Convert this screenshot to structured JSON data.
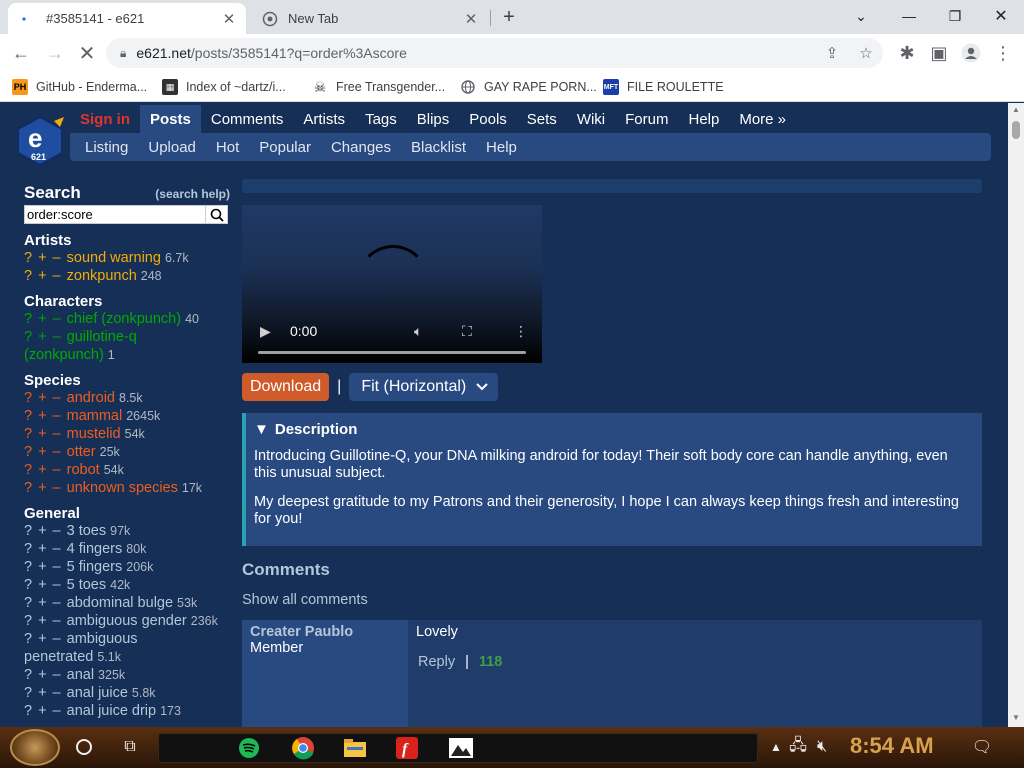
{
  "browser": {
    "tabs": [
      {
        "title": "#3585141 - e621",
        "active": true
      },
      {
        "title": "New Tab",
        "active": false
      }
    ],
    "url_host": "e621.net",
    "url_path": "/posts/3585141?q=order%3Ascore",
    "bookmarks": [
      {
        "label": "GitHub - Enderma...",
        "icon": "PH"
      },
      {
        "label": "Index of ~dartz/i...",
        "icon": "grid"
      },
      {
        "label": "Free Transgender...",
        "icon": "skull"
      },
      {
        "label": "GAY RAPE PORN...",
        "icon": "globe"
      },
      {
        "label": "FILE ROULETTE",
        "icon": "MFT"
      }
    ]
  },
  "site": {
    "nav": {
      "signin": "Sign in",
      "items": [
        "Posts",
        "Comments",
        "Artists",
        "Tags",
        "Blips",
        "Pools",
        "Sets",
        "Wiki",
        "Forum",
        "Help",
        "More »"
      ],
      "subitems": [
        "Listing",
        "Upload",
        "Hot",
        "Popular",
        "Changes",
        "Blacklist",
        "Help"
      ]
    },
    "search": {
      "title": "Search",
      "help": "(search help)",
      "value": "order:score"
    },
    "tag_groups": {
      "artists": {
        "title": "Artists",
        "tags": [
          {
            "name": "sound warning",
            "count": "6.7k"
          },
          {
            "name": "zonkpunch",
            "count": "248"
          }
        ]
      },
      "characters": {
        "title": "Characters",
        "tags": [
          {
            "name": "chief (zonkpunch)",
            "count": "40"
          },
          {
            "name": "guillotine-q (zonkpunch)",
            "count": "1"
          }
        ]
      },
      "species": {
        "title": "Species",
        "tags": [
          {
            "name": "android",
            "count": "8.5k"
          },
          {
            "name": "mammal",
            "count": "2645k"
          },
          {
            "name": "mustelid",
            "count": "54k"
          },
          {
            "name": "otter",
            "count": "25k"
          },
          {
            "name": "robot",
            "count": "54k"
          },
          {
            "name": "unknown species",
            "count": "17k"
          }
        ]
      },
      "general": {
        "title": "General",
        "tags": [
          {
            "name": "3 toes",
            "count": "97k"
          },
          {
            "name": "4 fingers",
            "count": "80k"
          },
          {
            "name": "5 fingers",
            "count": "206k"
          },
          {
            "name": "5 toes",
            "count": "42k"
          },
          {
            "name": "abdominal bulge",
            "count": "53k"
          },
          {
            "name": "ambiguous gender",
            "count": "236k"
          },
          {
            "name": "ambiguous penetrated",
            "count": "5.1k"
          },
          {
            "name": "anal",
            "count": "325k"
          },
          {
            "name": "anal juice",
            "count": "5.8k"
          },
          {
            "name": "anal juice drip",
            "count": "173"
          }
        ]
      }
    },
    "video": {
      "time": "0:00"
    },
    "actions": {
      "download": "Download",
      "separator": "|",
      "fit": "Fit (Horizontal)"
    },
    "description": {
      "title": "Description",
      "paragraphs": [
        "Introducing Guillotine-Q, your DNA milking android for today! Their soft body core can handle anything, even this unusual subject.",
        "My deepest gratitude to my Patrons and their generosity, I hope I can always keep things fresh and interesting for you!"
      ]
    },
    "comments": {
      "title": "Comments",
      "show_all": "Show all comments",
      "items": [
        {
          "author": "Creater Paublo",
          "level": "Member",
          "body": "Lovely",
          "reply": "Reply",
          "separator": "|",
          "score": "118"
        }
      ]
    }
  },
  "taskbar": {
    "clock": "8:54 AM"
  },
  "colors": {
    "site_bg": "#152f56",
    "nav_active": "#284a81",
    "artist_tag": "#f2ac08",
    "character_tag": "#00aa00",
    "species_tag": "#ed5d1f",
    "general_tag": "#b4c7d9",
    "download_button": "#d05b2a"
  }
}
